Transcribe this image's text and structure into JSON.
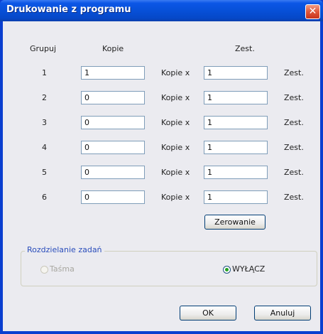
{
  "window": {
    "title": "Drukowanie z programu",
    "close_label": "✕"
  },
  "headers": {
    "group": "Grupuj",
    "copies": "Kopie",
    "sets": "Zest."
  },
  "rows": [
    {
      "group": "1",
      "copies": "1",
      "mult_label": "Kopie x",
      "sets": "1",
      "sets_unit": "Zest."
    },
    {
      "group": "2",
      "copies": "0",
      "mult_label": "Kopie x",
      "sets": "1",
      "sets_unit": "Zest."
    },
    {
      "group": "3",
      "copies": "0",
      "mult_label": "Kopie x",
      "sets": "1",
      "sets_unit": "Zest."
    },
    {
      "group": "4",
      "copies": "0",
      "mult_label": "Kopie x",
      "sets": "1",
      "sets_unit": "Zest."
    },
    {
      "group": "5",
      "copies": "0",
      "mult_label": "Kopie x",
      "sets": "1",
      "sets_unit": "Zest."
    },
    {
      "group": "6",
      "copies": "0",
      "mult_label": "Kopie x",
      "sets": "1",
      "sets_unit": "Zest."
    }
  ],
  "reset_button": "Zerowanie",
  "job_separation": {
    "legend": "Rozdzielanie zadań",
    "options": [
      {
        "label": "Taśma",
        "selected": false,
        "enabled": false
      },
      {
        "label": "WYŁĄCZ",
        "selected": true,
        "enabled": true
      }
    ]
  },
  "ok_button": "OK",
  "cancel_button": "Anuluj"
}
